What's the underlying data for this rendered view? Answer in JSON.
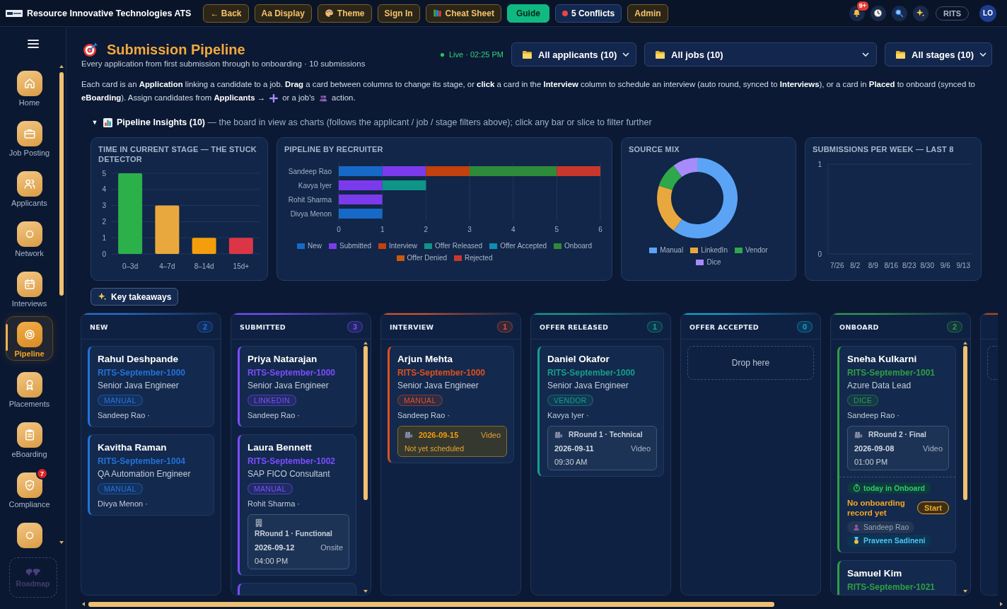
{
  "app_bar": {
    "title": "Resource Innovative Technologies ATS",
    "buttons": [
      {
        "label": "← Back",
        "kind": "outline"
      },
      {
        "label": "Aa Display",
        "kind": "outline"
      },
      {
        "label": "Theme",
        "kind": "outline"
      },
      {
        "label": "Sign In",
        "kind": "outline"
      },
      {
        "label": "Cheat Sheet",
        "kind": "outline"
      },
      {
        "label": "Guide",
        "kind": "primary"
      },
      {
        "label": "5 Conflicts",
        "kind": "alert"
      },
      {
        "label": "Admin",
        "kind": "outline"
      }
    ],
    "notification_count": "9+",
    "workspace": "RITS",
    "avatar": "LO"
  },
  "sidebar": {
    "items": [
      {
        "label": "Home",
        "selected": false
      },
      {
        "label": "Job Posting",
        "selected": false
      },
      {
        "label": "Applicants",
        "selected": false
      },
      {
        "label": "Network",
        "selected": false
      },
      {
        "label": "Interviews",
        "selected": false
      },
      {
        "label": "Pipeline",
        "selected": true
      },
      {
        "label": "Placements",
        "selected": false
      },
      {
        "label": "eBoarding",
        "selected": false
      },
      {
        "label": "Compliance",
        "selected": false,
        "badge": "7"
      },
      {
        "selected": false
      }
    ],
    "roadmap": {
      "label": "Roadmap",
      "disabled": true
    }
  },
  "header": {
    "title": "Submission Pipeline",
    "subtitle": "Every application from first submission through to onboarding · 10 submissions",
    "live": "Live · 02:25 PM",
    "filters": [
      "All applicants (10)",
      "All jobs (10)",
      "All stages (10)"
    ],
    "description": [
      "Each card is an **Application** linking a candidate to a job. **Drag** a card between columns to change its stage, or **click** a card in the **Interview** column to schedule an interview (auto round, synced to **Interviews**), or a card in **Placed** to onboard (synced to",
      "**eBoarding**). Assign candidates from **Applicants →**",
      "or a job's",
      "action."
    ]
  },
  "insights": {
    "expanded": true,
    "toggle": "▼",
    "heading": "**Pipeline Insights (10)** — the board in view as charts (follows the applicant / job / stage filters above); click any bar or slice to filter further",
    "charts": [
      {
        "title": "TIME IN CURRENT STAGE — THE STUCK DETECTOR",
        "chart_data": {
          "type": "bar",
          "categories": [
            "0–3d",
            "4–7d",
            "8–14d",
            "15d+"
          ],
          "values": [
            5,
            3,
            1,
            1
          ],
          "colors": [
            "#2bb04a",
            "#e9a83e",
            "#f59e0b",
            "#dc3545"
          ],
          "ylim": [
            0,
            5
          ],
          "yticks": [
            0,
            1,
            2,
            3,
            4,
            5
          ],
          "grid": true
        }
      },
      {
        "title": "PIPELINE BY RECRUITER",
        "chart_data": {
          "type": "bar",
          "orientation": "horizontal",
          "stacked": true,
          "categories": [
            "Sandeep Rao",
            "Kavya Iyer",
            "Rohit Sharma",
            "Divya Menon"
          ],
          "series": [
            {
              "name": "New",
              "color": "#1769c7",
              "values": [
                1,
                0,
                0,
                1
              ]
            },
            {
              "name": "Submitted",
              "color": "#7c3aed",
              "values": [
                1,
                1,
                1,
                0
              ]
            },
            {
              "name": "Interview",
              "color": "#c2410c",
              "values": [
                1,
                0,
                0,
                0
              ]
            },
            {
              "name": "Offer Released",
              "color": "#0f9488",
              "values": [
                0,
                1,
                0,
                0
              ]
            },
            {
              "name": "Offer Accepted",
              "color": "#0e8fb0",
              "values": [
                0,
                0,
                0,
                0
              ]
            },
            {
              "name": "Onboard",
              "color": "#2e8b3a",
              "values": [
                2,
                0,
                0,
                0
              ]
            },
            {
              "name": "Offer Denied",
              "color": "#c8590f",
              "values": [
                0,
                0,
                0,
                0
              ]
            },
            {
              "name": "Rejected",
              "color": "#c9372c",
              "values": [
                1,
                0,
                0,
                0
              ]
            }
          ],
          "xlim": [
            0,
            6
          ],
          "xticks": [
            0,
            1,
            2,
            3,
            4,
            5,
            6
          ],
          "grid": true,
          "legend": "bottom"
        }
      },
      {
        "title": "SOURCE MIX",
        "chart_data": {
          "type": "donut",
          "categories": [
            "Manual",
            "LinkedIn",
            "Vendor",
            "Dice"
          ],
          "values": [
            60,
            20,
            10,
            10
          ],
          "colors": [
            "#5ba3f5",
            "#e9a83e",
            "#2ea84a",
            "#a78bfa"
          ],
          "legend": "bottom"
        }
      },
      {
        "title": "SUBMISSIONS PER WEEK — LAST 8",
        "chart_data": {
          "type": "line",
          "x": [
            "7/26",
            "8/2",
            "8/9",
            "8/16",
            "8/23",
            "8/30",
            "9/6",
            "9/13"
          ],
          "ylim": [
            0,
            1
          ],
          "yticks": [
            0,
            1
          ],
          "grid": true
        }
      }
    ]
  },
  "takeaways": {
    "label": "Key takeaways"
  },
  "board": {
    "columns": [
      {
        "title": "NEW",
        "count": "2",
        "color": "#2272d9",
        "cards": [
          {
            "name": "Rahul Deshpande",
            "req": "RITS-September-1000",
            "job": "Senior Java Engineer",
            "source": "MANUAL",
            "recruiter": "Sandeep Rao ·"
          },
          {
            "name": "Kavitha Raman",
            "req": "RITS-September-1004",
            "job": "QA Automation Engineer",
            "source": "MANUAL",
            "recruiter": "Divya Menon ·"
          }
        ]
      },
      {
        "title": "SUBMITTED",
        "count": "3",
        "color": "#7c4dff",
        "scrollable": true,
        "cards": [
          {
            "name": "Priya Natarajan",
            "req": "RITS-September-1000",
            "job": "Senior Java Engineer",
            "source": "LINKEDIN",
            "recruiter": "Sandeep Rao ·"
          },
          {
            "name": "Laura Bennett",
            "req": "RITS-September-1002",
            "job": "SAP FICO Consultant",
            "source": "MANUAL",
            "recruiter": "Rohit Sharma ·",
            "interview": {
              "kind": "onsite",
              "scheduled": true,
              "round": "RRound 1 · Functional",
              "date": "2026-09-12",
              "mode": "Onsite",
              "time": "04:00 PM"
            }
          },
          {
            "cut_off": true
          }
        ]
      },
      {
        "title": "INTERVIEW",
        "count": "1",
        "color": "#e0501c",
        "cards": [
          {
            "name": "Arjun Mehta",
            "req": "RITS-September-1000",
            "job": "Senior Java Engineer",
            "source": "MANUAL",
            "recruiter": "Sandeep Rao ·",
            "interview": {
              "kind": "video",
              "scheduled": false,
              "date": "2026-09-15",
              "mode": "Video",
              "note": "Not yet scheduled"
            }
          }
        ]
      },
      {
        "title": "OFFER RELEASED",
        "count": "1",
        "color": "#14a08a",
        "cards": [
          {
            "name": "Daniel Okafor",
            "req": "RITS-September-1000",
            "job": "Senior Java Engineer",
            "source": "VENDOR",
            "recruiter": "Kavya Iyer ·",
            "interview": {
              "kind": "video",
              "scheduled": true,
              "round": "RRound 1 · Technical",
              "date": "2026-09-11",
              "mode": "Video",
              "time": "09:30 AM"
            }
          }
        ]
      },
      {
        "title": "OFFER ACCEPTED",
        "count": "0",
        "color": "#0ea5d0",
        "empty": true,
        "drop_text": "Drop here"
      },
      {
        "title": "ONBOARD",
        "count": "2",
        "color": "#2f9e44",
        "scrollable": true,
        "cards": [
          {
            "name": "Sneha Kulkarni",
            "req": "RITS-September-1001",
            "job": "Azure Data Lead",
            "source": "DICE",
            "recruiter": "Sandeep Rao ·",
            "interview": {
              "kind": "video",
              "scheduled": true,
              "round": "RRound 2 · Final",
              "date": "2026-09-08",
              "mode": "Video",
              "time": "01:00 PM"
            },
            "onboarding": {
              "since": "today in Onboard",
              "status": "No onboarding record yet",
              "action": "Start",
              "recruiter": "Sandeep Rao",
              "coordinator": "Praveen Sadineni"
            }
          },
          {
            "name": "Samuel Kim",
            "req": "RITS-September-1021"
          }
        ]
      },
      {
        "color": "#c2410c",
        "empty": true
      }
    ]
  }
}
